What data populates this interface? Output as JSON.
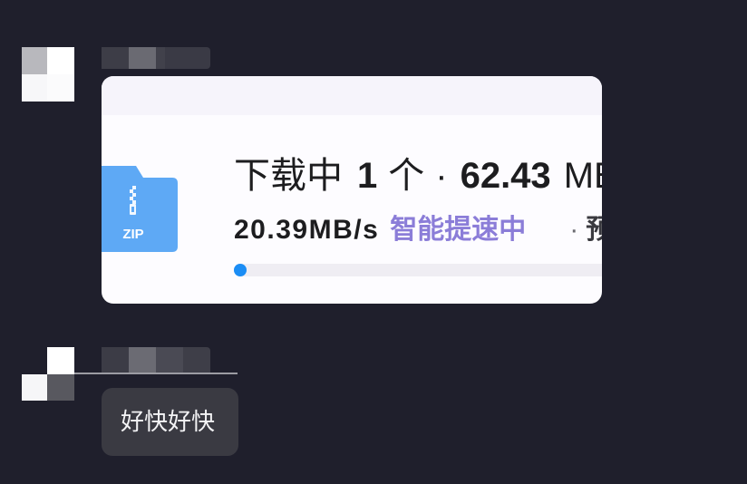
{
  "download_card": {
    "file_type_label": "ZIP",
    "file_icon": "zip-folder-icon",
    "status": "下载中",
    "count": "1",
    "count_unit": "个",
    "separator": "·",
    "size_value": "62.43",
    "size_unit": "MB",
    "speed": "20.39MB/s",
    "boost_label": "智能提速中",
    "boost_icon": "speed-lines-icon",
    "trailing_separator": "·",
    "trailing_text": "预",
    "progress": 0.02
  },
  "reply_message": {
    "text": "好快好快"
  },
  "colors": {
    "background": "#1f1f2c",
    "card_header": "#f6f4fb",
    "card_body": "#fdfcff",
    "folder_icon": "#5ea9f5",
    "boost_text": "#8b7dd8",
    "progress_track": "#efedf3",
    "progress_fill": "#1b8df5",
    "bubble": "#3a3a42"
  }
}
